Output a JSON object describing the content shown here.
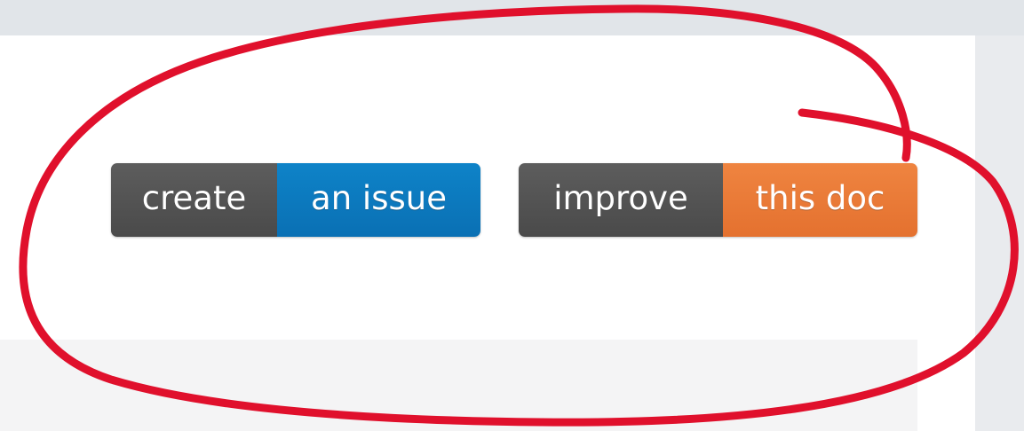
{
  "badges": {
    "create_issue": {
      "left_label": "create",
      "right_label": "an issue",
      "accent_color": "#0e7cc2"
    },
    "improve_doc": {
      "left_label": "improve",
      "right_label": "this doc",
      "accent_color": "#ec7a37"
    },
    "label_color": "#545454"
  },
  "annotation": {
    "shape": "hand-drawn-ellipse",
    "color": "#e0102c"
  }
}
